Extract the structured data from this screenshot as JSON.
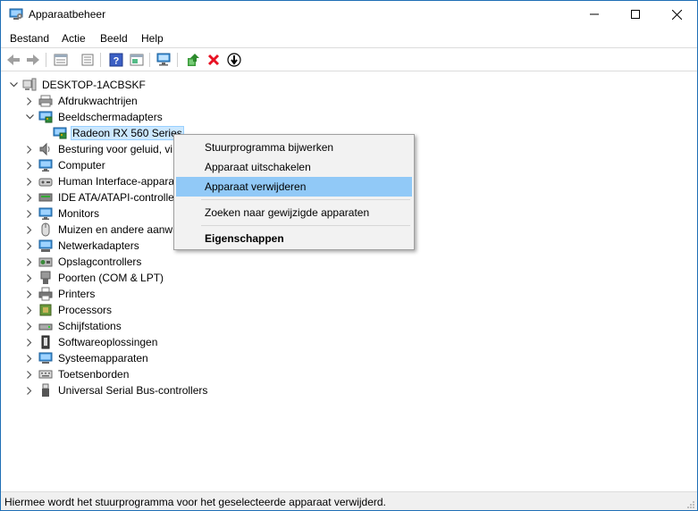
{
  "window": {
    "title": "Apparaatbeheer",
    "controls": [
      "minimize",
      "maximize",
      "close"
    ]
  },
  "menubar": {
    "items": [
      "Bestand",
      "Actie",
      "Beeld",
      "Help"
    ]
  },
  "toolbar": {
    "buttons": [
      "back-icon",
      "forward-icon",
      "properties-view-icon",
      "list-view-icon",
      "help-icon",
      "show-hidden-icon",
      "scan-hardware-icon",
      "update-driver-icon",
      "uninstall-icon",
      "disable-icon"
    ]
  },
  "tree": {
    "root": "DESKTOP-1ACBSKF",
    "nodes": [
      {
        "label": "Afdrukwachtrijen",
        "icon": "printer-queue-icon",
        "expanded": false
      },
      {
        "label": "Beeldschermadapters",
        "icon": "display-adapter-icon",
        "expanded": true
      },
      {
        "label": "Radeon RX 560 Series",
        "icon": "display-adapter-icon",
        "child": true,
        "selected": true
      },
      {
        "label": "Besturing voor geluid, vi",
        "icon": "speaker-icon",
        "expanded": false
      },
      {
        "label": "Computer",
        "icon": "monitor-icon",
        "expanded": false
      },
      {
        "label": "Human Interface-appara",
        "icon": "hid-icon",
        "expanded": false
      },
      {
        "label": "IDE ATA/ATAPI-controlle",
        "icon": "ide-icon",
        "expanded": false
      },
      {
        "label": "Monitors",
        "icon": "monitor-icon",
        "expanded": false
      },
      {
        "label": "Muizen en andere aanwi",
        "icon": "mouse-icon",
        "expanded": false
      },
      {
        "label": "Netwerkadapters",
        "icon": "network-icon",
        "expanded": false
      },
      {
        "label": "Opslagcontrollers",
        "icon": "storage-icon",
        "expanded": false
      },
      {
        "label": "Poorten (COM & LPT)",
        "icon": "port-icon",
        "expanded": false
      },
      {
        "label": "Printers",
        "icon": "printer-icon",
        "expanded": false
      },
      {
        "label": "Processors",
        "icon": "cpu-icon",
        "expanded": false
      },
      {
        "label": "Schijfstations",
        "icon": "disk-icon",
        "expanded": false
      },
      {
        "label": "Softwareoplossingen",
        "icon": "software-icon",
        "expanded": false
      },
      {
        "label": "Systeemapparaten",
        "icon": "system-icon",
        "expanded": false
      },
      {
        "label": "Toetsenborden",
        "icon": "keyboard-icon",
        "expanded": false
      },
      {
        "label": "Universal Serial Bus-controllers",
        "icon": "usb-icon",
        "expanded": false
      }
    ]
  },
  "context_menu": {
    "items": [
      {
        "label": "Stuurprogramma bijwerken"
      },
      {
        "label": "Apparaat uitschakelen"
      },
      {
        "label": "Apparaat verwijderen",
        "highlighted": true
      },
      {
        "label": "Zoeken naar gewijzigde apparaten"
      },
      {
        "label": "Eigenschappen",
        "bold": true
      }
    ]
  },
  "statusbar": {
    "text": "Hiermee wordt het stuurprogramma voor het geselecteerde apparaat verwijderd."
  },
  "colors": {
    "highlight": "#91c9f7",
    "selection": "#cce8ff",
    "window_border": "#1f6fb5",
    "delete_red": "#e81123"
  }
}
